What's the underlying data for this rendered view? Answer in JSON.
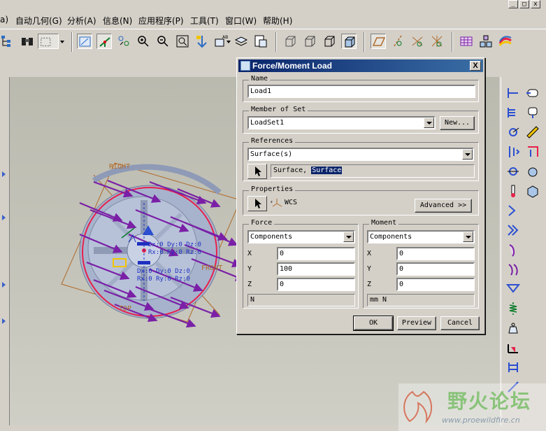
{
  "menubar": {
    "items": [
      "自动几何(G)",
      "分析(A)",
      "信息(N)",
      "应用程序(P)",
      "工具(T)",
      "窗口(W)",
      "帮助(H)"
    ]
  },
  "window_controls": {
    "minimize": "_",
    "maximize": "□",
    "close": "x"
  },
  "model": {
    "datum_labels": {
      "right": "RIGHT",
      "front": "FRONT",
      "top": "TOP"
    },
    "constraint_label_1": [
      "Dx:0 Dy:0 Dz:0",
      "Rx:0 Ry:0 Rz:0"
    ],
    "constraint_label_2": [
      "Dx:0 Dy:0 Dz:0",
      "Rx:0 Ry:0 Rz:0"
    ],
    "colors": {
      "load_arrow": "#7a1fa6",
      "surface": "#9aa8c8",
      "highlight": "#e8204a",
      "datum": "#b06a2a"
    }
  },
  "dialog": {
    "title": "Force/Moment Load",
    "close_label": "X",
    "name": {
      "label": "Name",
      "value": "Load1"
    },
    "member_of_set": {
      "label": "Member of Set",
      "value": "LoadSet1",
      "new_button": "New..."
    },
    "references": {
      "label": "References",
      "type": "Surface(s)",
      "selection_prefix": "Surface,",
      "selection_highlight": "Surface"
    },
    "properties": {
      "label": "Properties",
      "csys": "WCS",
      "advanced_button": "Advanced >>"
    },
    "force": {
      "label": "Force",
      "mode": "Components",
      "x_label": "X",
      "y_label": "Y",
      "z_label": "Z",
      "x": "0",
      "y": "100",
      "z": "0",
      "units": "N"
    },
    "moment": {
      "label": "Moment",
      "mode": "Components",
      "x_label": "X",
      "y_label": "Y",
      "z_label": "Z",
      "x": "0",
      "y": "0",
      "z": "0",
      "units": "mm N"
    },
    "buttons": {
      "ok": "OK",
      "preview": "Preview",
      "cancel": "Cancel"
    }
  },
  "watermark": {
    "text": "野火论坛",
    "url": "www.proewildfire.cn"
  }
}
